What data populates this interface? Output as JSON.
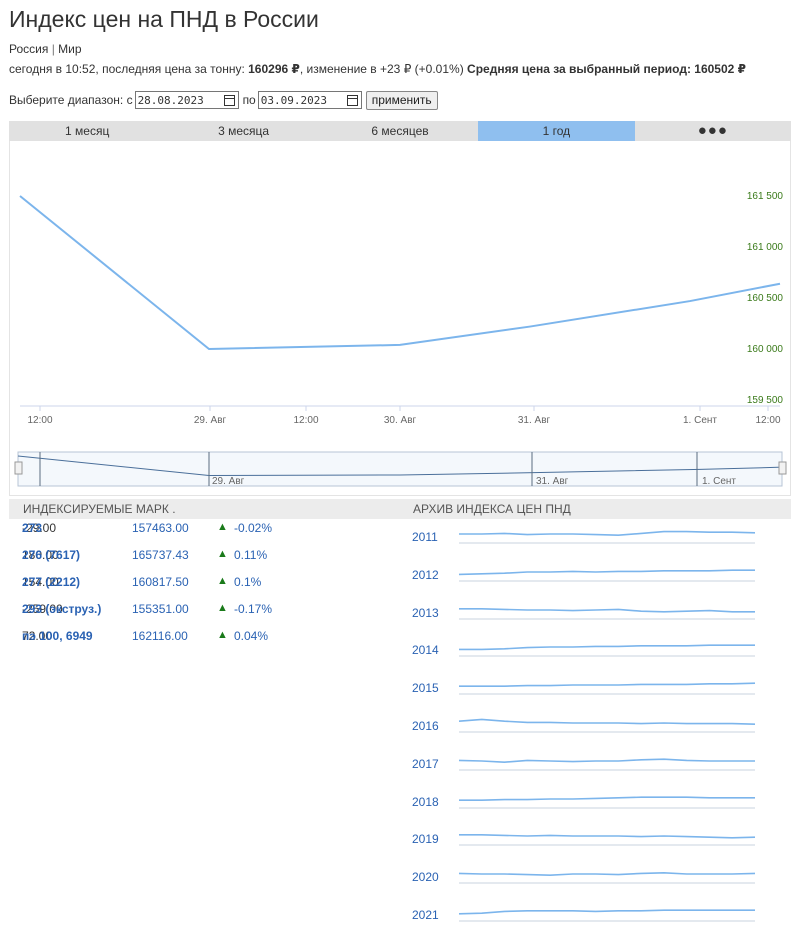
{
  "header": {
    "title": "Индекс цен на ПНД в России",
    "region": "Россия",
    "region_sep": "|",
    "scope": "Мир"
  },
  "stats": {
    "prefix": "сегодня в 10:52, последняя цена за тонну: ",
    "last_price": "160296 ₽",
    "change_text": ", изменение в +23 ₽ (+0.01%) ",
    "avg_label": "Средняя цена за выбранный период: ",
    "avg_price": "160502 ₽"
  },
  "range": {
    "label": "Выберите диапазон:",
    "from_label": "с",
    "from_value": "28.08.2023",
    "to_label": "по",
    "to_value": "03.09.2023",
    "apply_label": "применить"
  },
  "tabs": [
    {
      "label": "1 месяц",
      "active": false
    },
    {
      "label": "3 месяца",
      "active": false
    },
    {
      "label": "6 месяцев",
      "active": false
    },
    {
      "label": "1 год",
      "active": true
    },
    {
      "label": "●●●",
      "active": false
    }
  ],
  "colors": {
    "line": "#7cb5ec",
    "tab_active": "#8fbfef",
    "link": "#2a62b3",
    "axis_green": "#3a7a1a",
    "up_arrow": "#1a7a1a"
  },
  "chart_data": {
    "type": "line",
    "series": [
      {
        "x": [
          "28.08.2023 06:00",
          "29.08.2023 00:00",
          "30.08.2023 00:00",
          "31.08.2023 00:00",
          "01.09.2023 00:00",
          "01.09.2023 12:00"
        ],
        "values": [
          161500,
          160000,
          160040,
          160220,
          160470,
          160640
        ]
      }
    ],
    "x_ticks": [
      "12:00",
      "29. Авг",
      "12:00",
      "30. Авг",
      "31. Авг",
      "1. Сент",
      "12:00"
    ],
    "y_ticks": [
      "161 500",
      "161 000",
      "160 500",
      "160 000",
      "159 500"
    ],
    "y_tick_values": [
      161500,
      161000,
      160500,
      160000,
      159500
    ],
    "ylim": [
      159500,
      161500
    ],
    "grid": false,
    "navigator_labels": [
      "29. Авг",
      "31. Авг",
      "1. Сент"
    ]
  },
  "grades": {
    "title": "ИНДЕКСИРУЕМЫЕ МАРК .",
    "rows": [
      {
        "name": "273",
        "price": "157463.00",
        "arrow": "▲",
        "pct": "-0.02%",
        "change": "-29.00"
      },
      {
        "name": "276 (7617)",
        "price": "165737.43",
        "arrow": "▲",
        "pct": "0.11%",
        "change": "180.00"
      },
      {
        "name": "277 (2212)",
        "price": "160817.50",
        "arrow": "▲",
        "pct": "0.1%",
        "change": "154.00"
      },
      {
        "name": "293 (экструз.)",
        "price": "155351.00",
        "arrow": "▲",
        "pct": "-0.17%",
        "change": "-259.00"
      },
      {
        "name": "пэ 100, 6949",
        "price": "162116.00",
        "arrow": "▲",
        "pct": "0.04%",
        "change": "72.00"
      }
    ]
  },
  "archive": {
    "title": "АРХИВ ИНДЕКСА ЦЕН ПНД",
    "years": [
      "2011",
      "2012",
      "2013",
      "2014",
      "2015",
      "2016",
      "2017",
      "2018",
      "2019",
      "2020",
      "2021"
    ]
  }
}
